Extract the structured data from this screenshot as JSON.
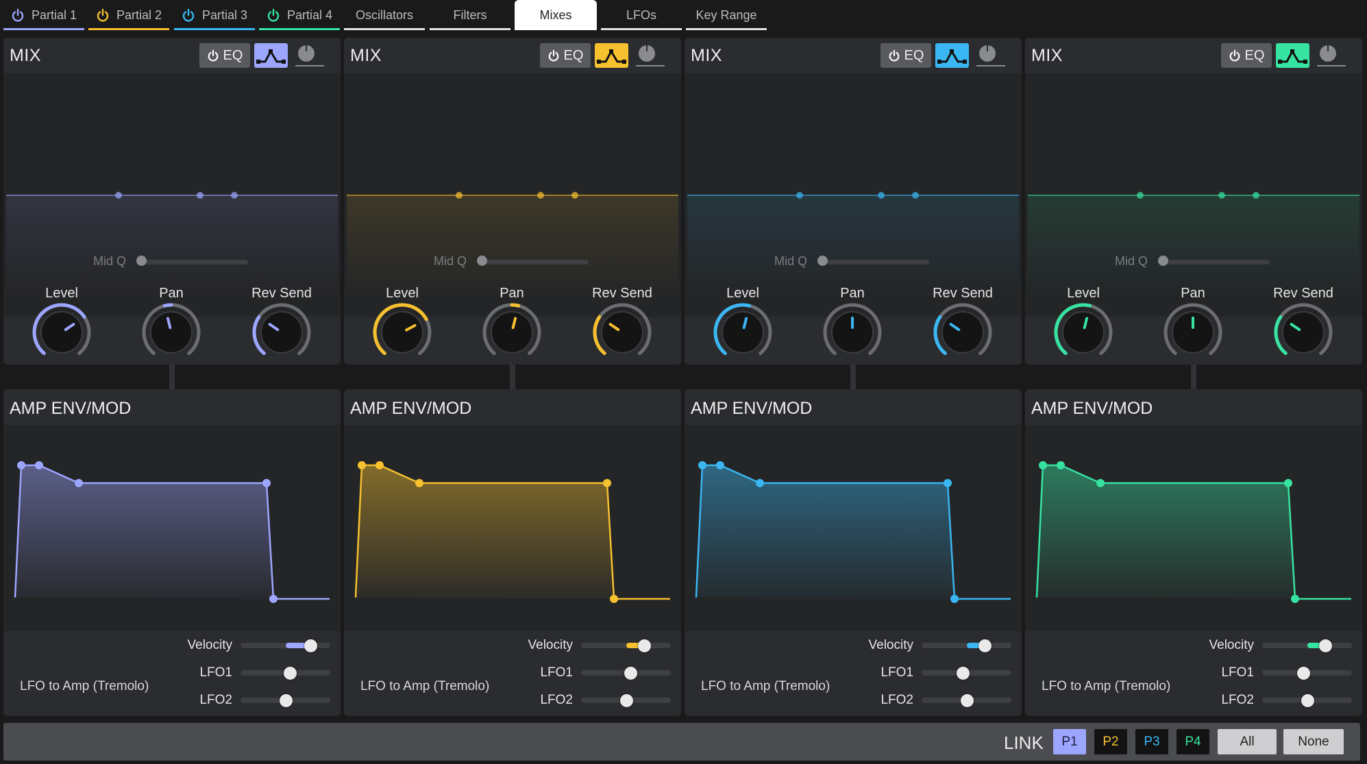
{
  "colors": {
    "partials": [
      "#9da6ff",
      "#f6c02f",
      "#3ab7f2",
      "#37e3a1"
    ],
    "active_tab_bg": "#ffffff",
    "panel_bg": "#2b2c2f"
  },
  "tabs": [
    {
      "label": "Partial 1",
      "has_power": true
    },
    {
      "label": "Partial 2",
      "has_power": true
    },
    {
      "label": "Partial 3",
      "has_power": true
    },
    {
      "label": "Partial 4",
      "has_power": true
    },
    {
      "label": "Oscillators",
      "has_power": false
    },
    {
      "label": "Filters",
      "has_power": false
    },
    {
      "label": "Mixes",
      "has_power": false,
      "active": true
    },
    {
      "label": "LFOs",
      "has_power": false
    },
    {
      "label": "Key Range",
      "has_power": false
    }
  ],
  "partials": [
    {
      "mix": {
        "title": "MIX",
        "eq_label": "EQ",
        "mid_q_label": "Mid Q",
        "mid_q_value": 0.0,
        "knobs": [
          {
            "label": "Level",
            "value": 0.7
          },
          {
            "label": "Pan",
            "value": 0.45
          },
          {
            "label": "Rev Send",
            "value": 0.3
          }
        ]
      },
      "amp": {
        "title": "AMP ENV/MOD",
        "tremolo_label": "LFO to Amp (Tremolo)",
        "sliders": [
          {
            "label": "Velocity",
            "value": 0.78,
            "filled": true
          },
          {
            "label": "LFO1",
            "value": 0.55,
            "filled": false
          },
          {
            "label": "LFO2",
            "value": 0.5,
            "filled": false
          }
        ]
      }
    },
    {
      "mix": {
        "title": "MIX",
        "eq_label": "EQ",
        "mid_q_label": "Mid Q",
        "mid_q_value": 0.0,
        "knobs": [
          {
            "label": "Level",
            "value": 0.72
          },
          {
            "label": "Pan",
            "value": 0.55
          },
          {
            "label": "Rev Send",
            "value": 0.3
          }
        ]
      },
      "amp": {
        "title": "AMP ENV/MOD",
        "tremolo_label": "LFO to Amp (Tremolo)",
        "sliders": [
          {
            "label": "Velocity",
            "value": 0.7,
            "filled": true
          },
          {
            "label": "LFO1",
            "value": 0.55,
            "filled": false
          },
          {
            "label": "LFO2",
            "value": 0.5,
            "filled": false
          }
        ]
      }
    },
    {
      "mix": {
        "title": "MIX",
        "eq_label": "EQ",
        "mid_q_label": "Mid Q",
        "mid_q_value": 0.0,
        "knobs": [
          {
            "label": "Level",
            "value": 0.55
          },
          {
            "label": "Pan",
            "value": 0.5
          },
          {
            "label": "Rev Send",
            "value": 0.3
          }
        ]
      },
      "amp": {
        "title": "AMP ENV/MOD",
        "tremolo_label": "LFO to Amp (Tremolo)",
        "sliders": [
          {
            "label": "Velocity",
            "value": 0.7,
            "filled": true
          },
          {
            "label": "LFO1",
            "value": 0.46,
            "filled": false
          },
          {
            "label": "LFO2",
            "value": 0.5,
            "filled": false
          }
        ]
      }
    },
    {
      "mix": {
        "title": "MIX",
        "eq_label": "EQ",
        "mid_q_label": "Mid Q",
        "mid_q_value": 0.0,
        "knobs": [
          {
            "label": "Level",
            "value": 0.55
          },
          {
            "label": "Pan",
            "value": 0.5
          },
          {
            "label": "Rev Send",
            "value": 0.3
          }
        ]
      },
      "amp": {
        "title": "AMP ENV/MOD",
        "tremolo_label": "LFO to Amp (Tremolo)",
        "sliders": [
          {
            "label": "Velocity",
            "value": 0.7,
            "filled": true
          },
          {
            "label": "LFO1",
            "value": 0.46,
            "filled": false
          },
          {
            "label": "LFO2",
            "value": 0.5,
            "filled": false
          }
        ]
      }
    }
  ],
  "link_bar": {
    "label": "LINK",
    "buttons": [
      {
        "label": "P1",
        "selected": true
      },
      {
        "label": "P2",
        "selected": false
      },
      {
        "label": "P3",
        "selected": false
      },
      {
        "label": "P4",
        "selected": false
      },
      {
        "label": "All",
        "selected": false
      },
      {
        "label": "None",
        "selected": false
      }
    ]
  }
}
